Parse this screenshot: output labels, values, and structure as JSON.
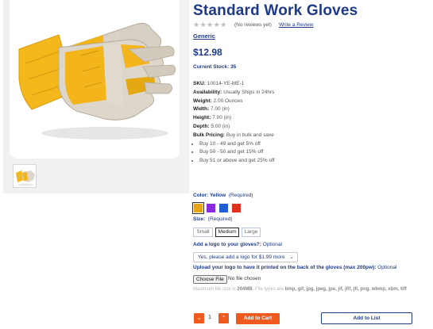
{
  "product": {
    "title": "Standard Work Gloves",
    "stars": "★★★★★",
    "reviews_text": "(No reviews yet)",
    "write_review": "Write a Review",
    "brand": "Generic",
    "price": "$12.98",
    "stock": "Current Stock: 35"
  },
  "specs": {
    "sku_label": "SKU:",
    "sku": "10014-YE-ME-1",
    "availability_label": "Availability:",
    "availability": "Usually Ships in 24hrs",
    "weight_label": "Weight:",
    "weight": "2.00 Ounces",
    "width_label": "Width:",
    "width": "7.00 (in)",
    "height_label": "Height:",
    "height": "7.00 (in)",
    "depth_label": "Depth:",
    "depth": "5.00 (in)",
    "bulk_label": "Bulk Pricing:",
    "bulk": "Buy in bulk and save",
    "bulk_tiers": [
      "Buy 10 - 49 and get 5% off",
      "Buy 50 - 50 and get 15% off",
      "Buy 51 or above and get 25% off"
    ]
  },
  "color": {
    "label": "Color:",
    "value": "Yellow",
    "required": "(Required)",
    "swatches": [
      "#e9a317",
      "#8a2be2",
      "#1e5fd6",
      "#e0301e"
    ],
    "selected_index": 0
  },
  "size": {
    "label": "Size:",
    "required": "(Required)",
    "options": [
      "Small",
      "Medium",
      "Large"
    ],
    "selected": "Medium"
  },
  "logo": {
    "label": "Add a logo to your gloves?:",
    "optional": "Optional",
    "select_value": "Yes, please add a logo for $1.99 more",
    "upload_label": "Upload your logo to have it printed on the back of the gloves (max 200pw):",
    "upload_optional": "Optional",
    "choose_file": "Choose File",
    "no_file": "No file chosen",
    "max_size_prefix": "Maximum file size is",
    "max_size_value": "204MB",
    "file_types_prefix": ". File types are",
    "file_types": "bmp, gif, jpg, jpeg, jpe, jif, jfif, jfi, png, wbmp, xbm, tiff"
  },
  "actions": {
    "minus": "−",
    "quantity": "1",
    "plus": "+",
    "add_to_cart": "Add to Cart",
    "add_to_list": "Add to List"
  },
  "icons": {
    "decrement": "chevron-down-icon",
    "increment": "chevron-up-icon",
    "select_chevron": "chevron-down-icon"
  }
}
